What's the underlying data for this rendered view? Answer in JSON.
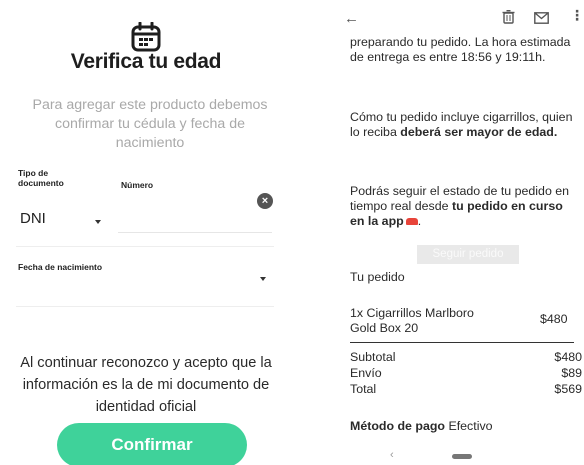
{
  "left": {
    "title": "Verifica tu edad",
    "description": "Para agregar este producto debemos confirmar tu cédula y fecha de nacimiento",
    "doc_type_label": "Tipo de documento",
    "numero_label": "Número",
    "doc_type_value": "DNI",
    "fecha_label": "Fecha de nacimiento",
    "terms": "Al continuar reconozco y acepto que la información es la de mi documento de identidad oficial",
    "confirm_label": "Confirmar",
    "icons": {
      "calendar": "calendar-icon",
      "clear": "clear-icon",
      "dropdown": "chevron-down-icon"
    },
    "accent_color": "#3fd29a"
  },
  "right": {
    "p1": "preparando tu pedido. La hora estimada de entrega es entre 18:56 y 19:11h.",
    "p2_prefix": "Cómo tu pedido incluye cigarrillos, quien lo reciba ",
    "p2_bold": "deberá ser mayor de edad.",
    "p3_prefix": "Podrás seguir el estado de tu pedido en tiempo real desde ",
    "p3_bold": "tu pedido en curso en la app",
    "p3_suffix": ".",
    "seguir_label": "Seguir pedido",
    "tu_pedido": "Tu pedido",
    "item_name": "1x Cigarrillos Marlboro Gold Box 20",
    "item_price": "$480",
    "subtotal_label": "Subtotal",
    "subtotal_value": "$480",
    "envio_label": "Envío",
    "envio_value": "$89",
    "total_label": "Total",
    "total_value": "$569",
    "pago_label": "Método de pago",
    "pago_value": "Efectivo",
    "icons": {
      "back": "back-arrow-icon",
      "delete": "trash-icon",
      "mail": "mail-icon",
      "more": "more-vert-icon"
    }
  }
}
